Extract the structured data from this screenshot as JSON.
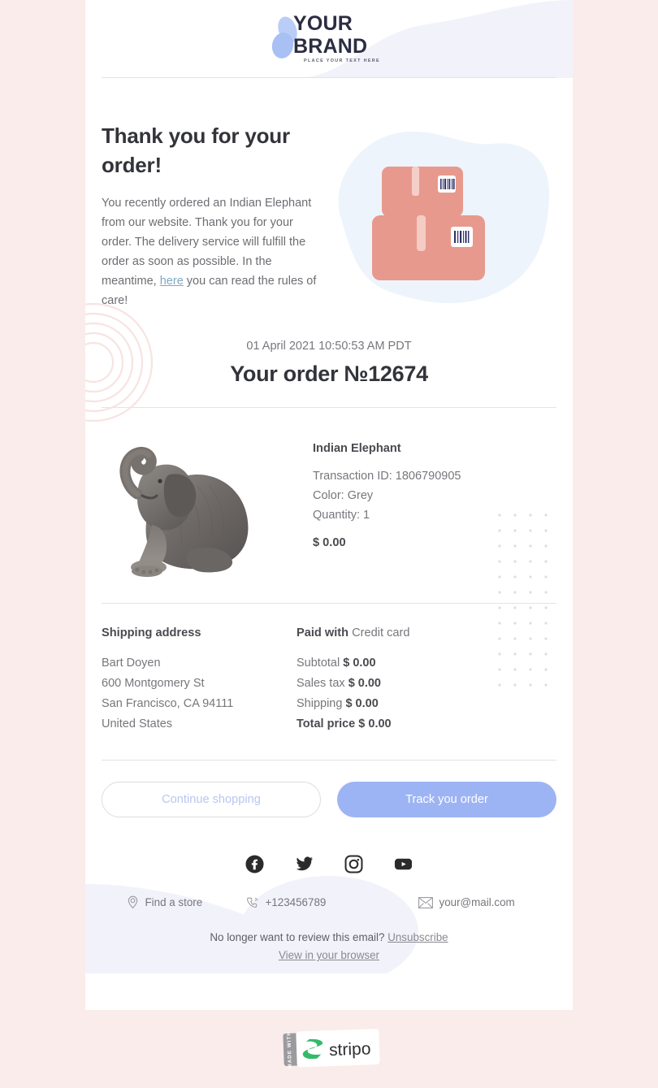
{
  "colors": {
    "page_bg": "#f9ecea",
    "card_bg": "#ffffff",
    "accent_blue": "#9db4f4",
    "link_blue": "#7fa8c4",
    "box_salmon": "#e8998d",
    "blob_lavender": "#f2f2fb",
    "rings_pink": "#f7e6e4"
  },
  "header": {
    "logo_line1": "YOUR",
    "logo_line2": "BRAND",
    "tagline": "PLACE YOUR TEXT HERE"
  },
  "intro": {
    "heading": "Thank you for your order!",
    "body_part1": "You recently ordered an Indian Elephant from our website. Thank you for your order. The delivery service will fulfill the order as soon as possible. In the meantime, ",
    "link_text": "here",
    "body_part2": " you can read the rules of care!",
    "illustration": "package-boxes-illustration"
  },
  "order": {
    "date": "01 April 2021 10:50:53 AM PDT",
    "number_label": "Your order №12674"
  },
  "product": {
    "image_name": "indian-elephant-photo",
    "title": "Indian Elephant",
    "transaction": "Transaction ID: 1806790905",
    "color": "Color: Grey",
    "quantity": "Quantity: 1",
    "price": "$ 0.00"
  },
  "shipping": {
    "heading": "Shipping address",
    "name": "Bart Doyen",
    "street": "600 Montgomery St",
    "city": "San Francisco, CA 94111",
    "country": "United States"
  },
  "payment": {
    "paid_with_label": "Paid with",
    "paid_with_value": "Credit card",
    "subtotal_label": "Subtotal",
    "subtotal_value": "$ 0.00",
    "salestax_label": "Sales tax",
    "salestax_value": "$ 0.00",
    "shipping_label": "Shipping",
    "shipping_value": "$ 0.00",
    "total_label": "Total price",
    "total_value": "$ 0.00"
  },
  "buttons": {
    "continue": "Continue shopping",
    "track": "Track you order"
  },
  "social": [
    {
      "name": "facebook-icon"
    },
    {
      "name": "twitter-icon"
    },
    {
      "name": "instagram-icon"
    },
    {
      "name": "youtube-icon"
    }
  ],
  "contacts": {
    "store": "Find a store",
    "phone": "+123456789",
    "email": "your@mail.com"
  },
  "legal": {
    "unsub_text": "No longer want to review this email? ",
    "unsub_link": "Unsubscribe",
    "view_browser": "View in your browser"
  },
  "badge": {
    "made_with": "MADE WITH",
    "brand": "stripo"
  }
}
